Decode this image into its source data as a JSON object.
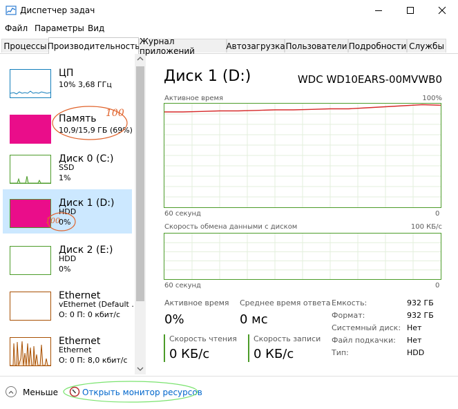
{
  "window": {
    "title": "Диспетчер задач"
  },
  "menu": [
    "Файл",
    "Параметры",
    "Вид"
  ],
  "tabs": [
    "Процессы",
    "Производительность",
    "Журнал приложений",
    "Автозагрузка",
    "Пользователи",
    "Подробности",
    "Службы"
  ],
  "active_tab": 1,
  "sidebar": {
    "items": [
      {
        "name": "ЦП",
        "sub1": "10% 3,68 ГГц",
        "sub2": "",
        "sub3": ""
      },
      {
        "name": "Память",
        "sub1": "10,9/15,9 ГБ (69%)",
        "sub2": "",
        "sub3": ""
      },
      {
        "name": "Диск 0 (C:)",
        "sub1": "SSD",
        "sub2": "1%",
        "sub3": ""
      },
      {
        "name": "Диск 1 (D:)",
        "sub1": "HDD",
        "sub2": "0%",
        "sub3": ""
      },
      {
        "name": "Диск 2 (E:)",
        "sub1": "HDD",
        "sub2": "0%",
        "sub3": ""
      },
      {
        "name": "Ethernet",
        "sub1": "vEthernet (Default ...",
        "sub2": "О: 0 П: 0 кбит/с",
        "sub3": ""
      },
      {
        "name": "Ethernet",
        "sub1": "Ethernet",
        "sub2": "О: 0 П: 8,0 кбит/с",
        "sub3": ""
      }
    ],
    "selected": 3
  },
  "main": {
    "title": "Диск 1 (D:)",
    "model": "WDC WD10EARS-00MVWB0",
    "chart1": {
      "label": "Активное время",
      "max": "100%",
      "xleft": "60 секунд",
      "xright": "0"
    },
    "chart2": {
      "label": "Скорость обмена данными с диском",
      "max": "100 КБ/с",
      "xleft": "60 секунд",
      "xright": "0"
    },
    "stats": {
      "active_label": "Активное время",
      "active_value": "0%",
      "resp_label": "Среднее время ответа",
      "resp_value": "0 мс",
      "read_label": "Скорость чтения",
      "read_value": "0 КБ/с",
      "write_label": "Скорость записи",
      "write_value": "0 КБ/с"
    },
    "props": [
      {
        "label": "Емкость:",
        "value": "932 ГБ"
      },
      {
        "label": "Формат:",
        "value": "932 ГБ"
      },
      {
        "label": "Системный диск:",
        "value": "Нет"
      },
      {
        "label": "Файл подкачки:",
        "value": "Нет"
      },
      {
        "label": "Тип:",
        "value": "HDD"
      }
    ]
  },
  "footer": {
    "less_label": "Меньше",
    "monitor_label": "Открыть монитор ресурсов"
  },
  "annotations": {
    "memory_note": "100",
    "disk_note": "100"
  },
  "colors": {
    "disk_green": "#4b9b28",
    "cpu_blue": "#117dbb",
    "memory_magenta": "#ea0d8a",
    "ethernet_orange": "#a74f01",
    "selected_bg": "#cce8ff",
    "annotation_orange": "#e0622a",
    "annotation_green": "#7ae36e",
    "line_red": "#d62a2a"
  },
  "chart_data": [
    {
      "type": "line",
      "title": "Активное время",
      "xlabel": "",
      "ylabel": "",
      "ylim": [
        0,
        100
      ],
      "x_range": [
        60,
        0
      ],
      "series": [
        {
          "values": [
            92,
            92,
            92.5,
            93,
            93,
            93.5,
            94,
            94,
            94.5,
            95,
            95,
            96,
            97,
            98,
            99,
            98.5
          ]
        }
      ]
    },
    {
      "type": "line",
      "title": "Скорость обмена данными с диском",
      "xlabel": "",
      "ylabel": "",
      "ylim": [
        0,
        100
      ],
      "x_range": [
        60,
        0
      ],
      "series": []
    }
  ]
}
